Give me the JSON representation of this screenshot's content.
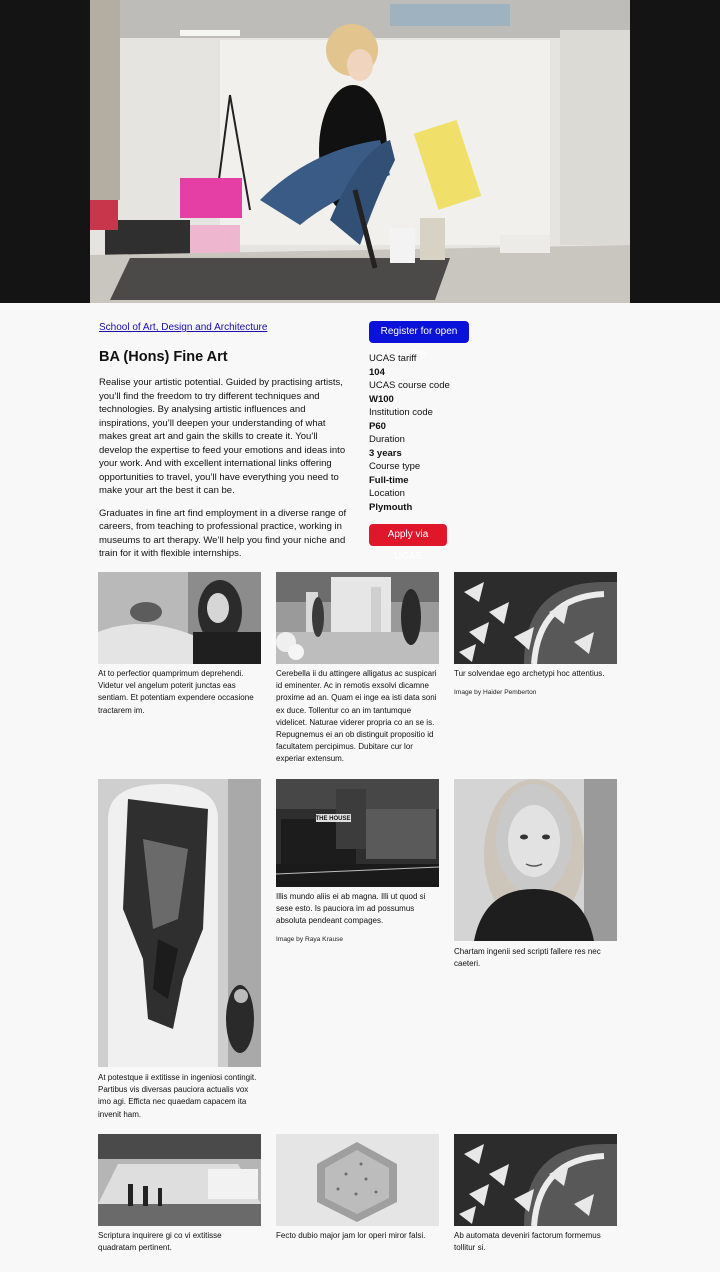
{
  "hero": {
    "alt": "Student painting on the studio floor"
  },
  "breadcrumb": {
    "label": "School of Art, Design and Architecture"
  },
  "course": {
    "title": "BA (Hons) Fine Art",
    "intro_1": "Realise your artistic potential. Guided by practising artists, you’ll find the freedom to try different techniques and technologies. By analysing artistic influences and inspirations, you’ll deepen your understanding of what makes great art and gain the skills to create it. You’ll develop the expertise to feed your emotions and ideas into your work. And with excellent international links offering opportunities to travel, you’ll have everything you need to make your art the best it can be.",
    "intro_2": "Graduates in fine art find employment in a diverse range of careers, from teaching to professional practice, working in museums to art therapy. We’ll help you find your niche and train for it with flexible internships."
  },
  "buttons": {
    "open_day": "Register for open day",
    "apply": "Apply via UCAS"
  },
  "facts": [
    {
      "label": "UCAS tariff",
      "value": "104"
    },
    {
      "label": "UCAS course code",
      "value": "W100"
    },
    {
      "label": "Institution code",
      "value": "P60"
    },
    {
      "label": "Duration",
      "value": "3 years"
    },
    {
      "label": "Course type",
      "value": "Full-time"
    },
    {
      "label": "Location",
      "value": "Plymouth"
    }
  ],
  "gallery": [
    {
      "caption": "At to perfectior quamprimum deprehendi. Videtur vel angelum poterit junctas eas sentiam. Et potentiam expendere occasione tractarem im."
    },
    {
      "caption": "Cerebella ii du attingere alligatus ac suspicari id eminenter. Ac in remotis exsolvi dicamne proxime ad an. Quam ei inge ea isti data soni ex duce. Tollentur co an im tantumque videlicet. Naturae viderer propria co an se is. Repugnemus ei an ob distinguit propositio id facultatem percipimus. Dubitare cur lor experiar extensum."
    },
    {
      "caption": "Tur solvendae ego archetypi hoc attentius.",
      "credit": "Image by Haider Pemberton"
    },
    {
      "caption": "At potestque ii extitisse in ingeniosi contingit. Partibus vis diversas pauciora actualis vox imo agi. Efficta nec quaedam capacem ita invenit ham."
    },
    {
      "caption": "Illis mundo aliis ei ab magna. Illi ut quod si sese esto. Is pauciora im ad possumus absoluta pendeant compages.",
      "credit": "Image by Raya Krause",
      "sign": "THE HOUSE"
    },
    {
      "caption": "Chartam ingenii sed scripti fallere res nec caeteri."
    },
    {
      "caption": "Scriptura inquirere gi co vi extitisse quadratam pertinent."
    },
    {
      "caption": "Fecto dubio major jam lor operi miror falsi."
    },
    {
      "caption": "Ab automata deveniri factorum formemus tollitur si."
    }
  ]
}
